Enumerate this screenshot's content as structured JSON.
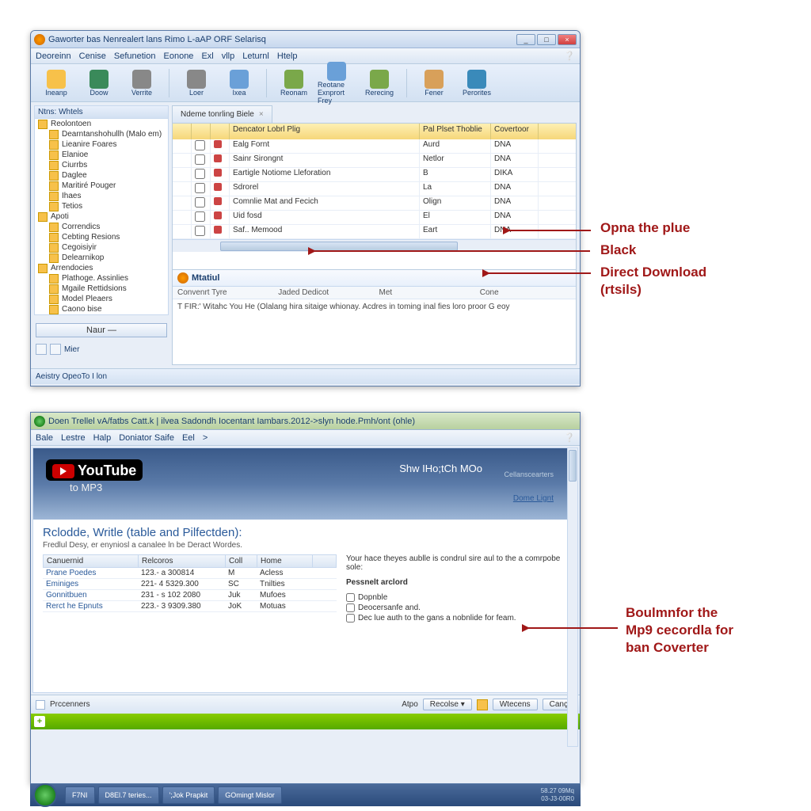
{
  "win1": {
    "title": "Gaworter bas Nenrealert lans Rimo L-aAP ORF Selarisq",
    "menu": [
      "Deoreinn",
      "Cenise",
      "Sefunetion",
      "Eonone",
      "Exl",
      "vllp",
      "Leturnl",
      "Htelp"
    ],
    "toolbar": [
      {
        "label": "Ineanp",
        "color": "#f7c14a"
      },
      {
        "label": "Doow",
        "color": "#3a8a5a"
      },
      {
        "label": "Verrite",
        "color": "#888"
      },
      {
        "label": "Loer",
        "color": "#888"
      },
      {
        "label": "Ixea",
        "color": "#6aa0d8"
      },
      {
        "label": "Reonam",
        "color": "#7aa84a"
      },
      {
        "label": "Reotane Exnprort Frey",
        "color": "#6aa0d8"
      },
      {
        "label": "Rerecing",
        "color": "#7aa84a"
      },
      {
        "label": "Fener",
        "color": "#d8a05a"
      },
      {
        "label": "Perorites",
        "color": "#3a8aba"
      }
    ],
    "tree_header": "Ntns: Whtels",
    "tree": [
      {
        "l": "Reolontoen",
        "lvl": 1
      },
      {
        "l": "Dearntanshohullh (Malo em)",
        "lvl": 2
      },
      {
        "l": "Lieanire Foares",
        "lvl": 2
      },
      {
        "l": "Elanioe",
        "lvl": 2
      },
      {
        "l": "Ciurrbs",
        "lvl": 2
      },
      {
        "l": "Daglee",
        "lvl": 2
      },
      {
        "l": "Maritiré Pouger",
        "lvl": 2
      },
      {
        "l": "Ihaes",
        "lvl": 2
      },
      {
        "l": "Tetios",
        "lvl": 2
      },
      {
        "l": "Apoti",
        "lvl": 1
      },
      {
        "l": "Correndics",
        "lvl": 2
      },
      {
        "l": "Cebting Resions",
        "lvl": 2
      },
      {
        "l": "Cegoisiyir",
        "lvl": 2
      },
      {
        "l": "Delearnikop",
        "lvl": 2
      },
      {
        "l": "Arrendocies",
        "lvl": 1
      },
      {
        "l": "Plathoge. Assinlies",
        "lvl": 2
      },
      {
        "l": "Mgaile Rettidsions",
        "lvl": 2
      },
      {
        "l": "Model Pleaers",
        "lvl": 2
      },
      {
        "l": "Caono bise",
        "lvl": 2
      }
    ],
    "new_button": "Naur —",
    "tab_label": "Ndeme tonrling Biele",
    "grid_headers": [
      "",
      "",
      "",
      "Dencator Lobrl Plig",
      "Pal Plset Thoblie",
      "Covertoor"
    ],
    "grid_rows": [
      [
        "",
        "",
        "",
        "Ealg Fornt",
        "Aurd",
        "DNA"
      ],
      [
        "",
        "",
        "",
        "Sainr Sirongnt",
        "Netlor",
        "DNA"
      ],
      [
        "",
        "",
        "",
        "Eartigle Notiome Lleforation",
        "B",
        "DIKA"
      ],
      [
        "",
        "",
        "",
        "Sdrorel",
        "La",
        "DNA"
      ],
      [
        "",
        "",
        "",
        "Comnlie Mat and Fecich",
        "Olign",
        "DNA"
      ],
      [
        "",
        "",
        "",
        "Uid fosd",
        "El",
        "DNA"
      ],
      [
        "",
        "",
        "",
        "Saf.. Memood",
        "Eart",
        "DNA"
      ]
    ],
    "detail_title": "Mtatiul",
    "detail_cols": [
      "Convenrt Tyre",
      "Jaded Dedicot",
      "Met",
      "Cone"
    ],
    "detail_body": "T FIR:' Witahc You He (Olalang hira sitaige whionay. Acdres in toming inal fies loro proor G eoy",
    "status_left": "Mier",
    "status": "Aeistry OpeoTo I lon"
  },
  "win2": {
    "title": "Doen Trellel vA/fatbs Catt.k | ilvea Sadondh Iocentant Iambars.2012->slyn hode.Pmh/ont (ohle)",
    "menu": [
      "Bale",
      "Lestre",
      "Halp",
      "Doniator Saife",
      "Eel",
      ">"
    ],
    "banner_top": "Shw IHo;tCh MOo",
    "banner_small1": "Cellanscearters",
    "banner_small2": "Dome Lignt",
    "logo_text": "YouTube",
    "logo_sub": "to MP3",
    "heading": "Rclodde, Writle (table and Pilfectden):",
    "subheading": "Fredlul Desy, er enyniosl a canalee ln be Deract Wordes.",
    "tbl_headers": [
      "Canuernid",
      "Relcoros",
      "Coll",
      "Home"
    ],
    "tbl_rows": [
      [
        "Prane Poedes",
        "123.- a 300814",
        "M",
        "Acless"
      ],
      [
        "Eminiges",
        "221- 4 5329.300",
        "SC",
        "Tnilties"
      ],
      [
        "Gonnitbuen",
        "231 - s 102 2080",
        "Juk",
        "Mufoes"
      ],
      [
        "Rerct he Epnuts",
        "223.- 3 9309.380",
        "JoK",
        "Motuas"
      ]
    ],
    "right_text": "Your hace theyes aublle is condrul sire aul to the a comrpobe sole:",
    "right_sub": "Pessnelt arclord",
    "checks": [
      "Dopnble",
      "Deocersanfe and.",
      "Dec lue auth to the gans a nobnlide for feam."
    ],
    "bottom": {
      "left": "Prccenners",
      "mid": "Atpo",
      "btn1": "Recolse ▾",
      "btn2": "Wtecens",
      "btn3": "Canç"
    }
  },
  "taskbar": {
    "items": [
      "F7NI",
      "D8El.7 teries...",
      "';Jok Prapkit",
      "GOmingt Mislor"
    ],
    "clock": "58.27 09Mq\n03-J3-00R0"
  },
  "annotations": {
    "a1": "Opna the plue",
    "a2": "Black",
    "a3": "Direct Download",
    "a3b": "(rtsils)",
    "a4a": "Boulmnfor the",
    "a4b": "Mp9 cecordla for",
    "a4c": "ban Coverter"
  }
}
